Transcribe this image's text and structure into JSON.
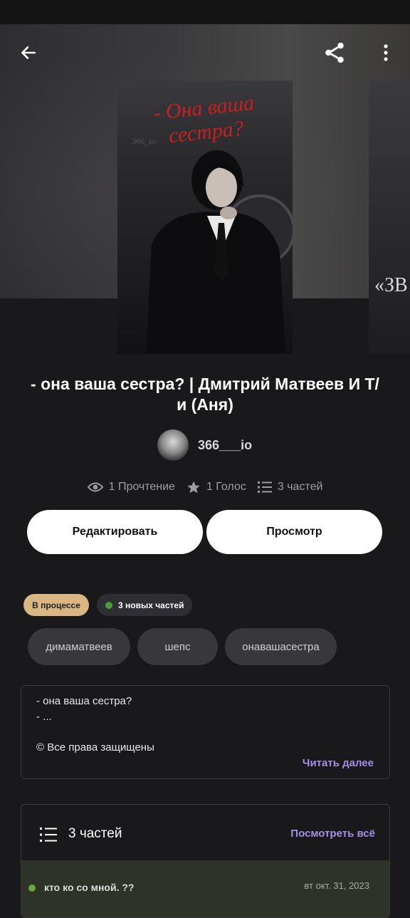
{
  "story": {
    "title": "- она ваша сестра? | Дмитрий Матвеев И Т/и (Аня)",
    "cover_title": "- Она ваша сестра?",
    "cover_mark": "366_io",
    "next_cover_text": "«ЗВ"
  },
  "author": {
    "name": "366___io"
  },
  "stats": {
    "reads": "1 Прочтение",
    "votes": "1 Голос",
    "parts": "3 частей"
  },
  "actions": {
    "edit_label": "Редактировать",
    "view_label": "Просмотр"
  },
  "badges": {
    "status": "В процессе",
    "new_parts": "3 новых частей"
  },
  "tags": [
    "димаматвеев",
    "шепс",
    "онавашасестра"
  ],
  "description": {
    "lines": [
      "- она ваша сестра?",
      "- ...",
      "© Все права защищены"
    ],
    "read_more": "Читать далее"
  },
  "parts_section": {
    "title": "3 частей",
    "see_all": "Посмотреть всё",
    "first_part_title": "кто ко со мной. ??",
    "first_part_date": "вт окт. 31, 2023"
  },
  "colors": {
    "accent": "#a58fe3",
    "status_badge": "#d9b682",
    "new_dot": "#4a9d3c"
  },
  "icons": {
    "back": "arrow-left-icon",
    "share": "share-icon",
    "menu": "more-vertical-icon"
  }
}
